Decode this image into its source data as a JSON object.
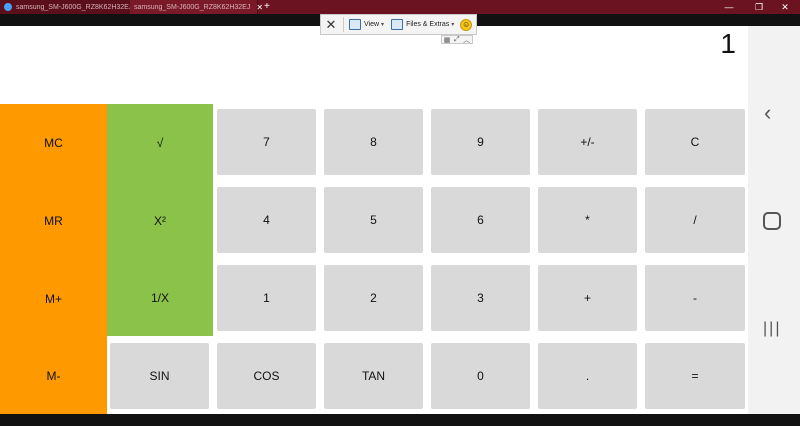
{
  "window": {
    "tabs": [
      {
        "label": "samsung_SM-J600G_RZ8K62H32EJ",
        "close": ""
      },
      {
        "label": "samsung_SM-J600G_RZ8K62H32EJ",
        "close": "✕"
      }
    ],
    "new_tab": "+",
    "controls": {
      "minimize": "—",
      "maximize": "❐",
      "close": "✕"
    }
  },
  "remote_toolbar": {
    "close": "✕",
    "view_label": "View",
    "files_label": "Files & Extras",
    "caret": "▾",
    "smiley": "☺",
    "sub_controls": [
      "▦",
      "⤢",
      "︿"
    ]
  },
  "calculator": {
    "display": "1",
    "memory_keys": [
      "MC",
      "MR",
      "M+",
      "M-"
    ],
    "function_keys": [
      "√",
      "X²",
      "1/X"
    ],
    "rows": [
      [
        "7",
        "8",
        "9",
        "+/-",
        "C"
      ],
      [
        "4",
        "5",
        "6",
        "*",
        "/"
      ],
      [
        "1",
        "2",
        "3",
        "+",
        "-"
      ],
      [
        "SIN",
        "COS",
        "TAN",
        "0",
        ".",
        "="
      ]
    ]
  },
  "navbar": {
    "back": "‹",
    "recent": "|||"
  },
  "colors": {
    "memory": "#ff9900",
    "function": "#8bc34a",
    "keypad": "#d9d9d9",
    "titlebar": "#6b1320"
  }
}
